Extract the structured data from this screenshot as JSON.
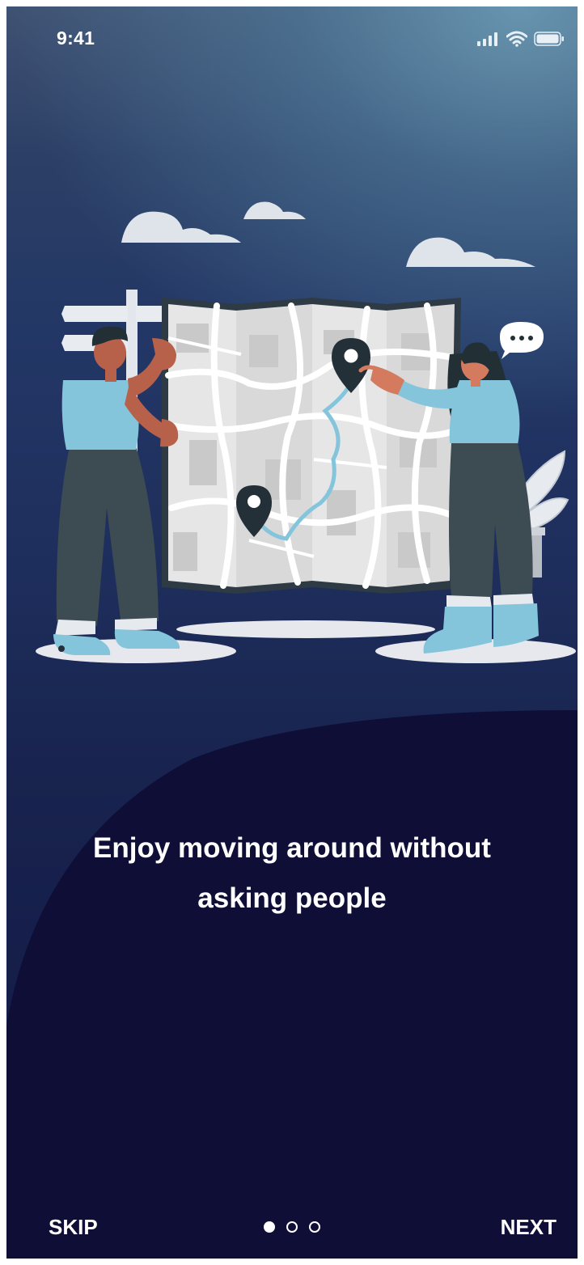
{
  "status_bar": {
    "time": "9:41",
    "icons": [
      "cellular-signal-icon",
      "wifi-icon",
      "battery-icon"
    ]
  },
  "illustration": {
    "subject": "two-people-reading-city-map",
    "icons": [
      "cloud-icon",
      "signpost-icon",
      "map-pin-icon",
      "speech-bubble-icon",
      "potted-plant-icon"
    ]
  },
  "onboarding": {
    "headline_line1": "Enjoy moving around without",
    "headline_line2": "asking people"
  },
  "pager": {
    "total": 3,
    "active_index": 0
  },
  "footer": {
    "skip_label": "SKIP",
    "next_label": "NEXT"
  },
  "colors": {
    "background_top": "#3f5273",
    "background_bottom": "#121644",
    "panel": "#0e0e36",
    "text": "#ffffff",
    "accent": "#84c5dc"
  }
}
